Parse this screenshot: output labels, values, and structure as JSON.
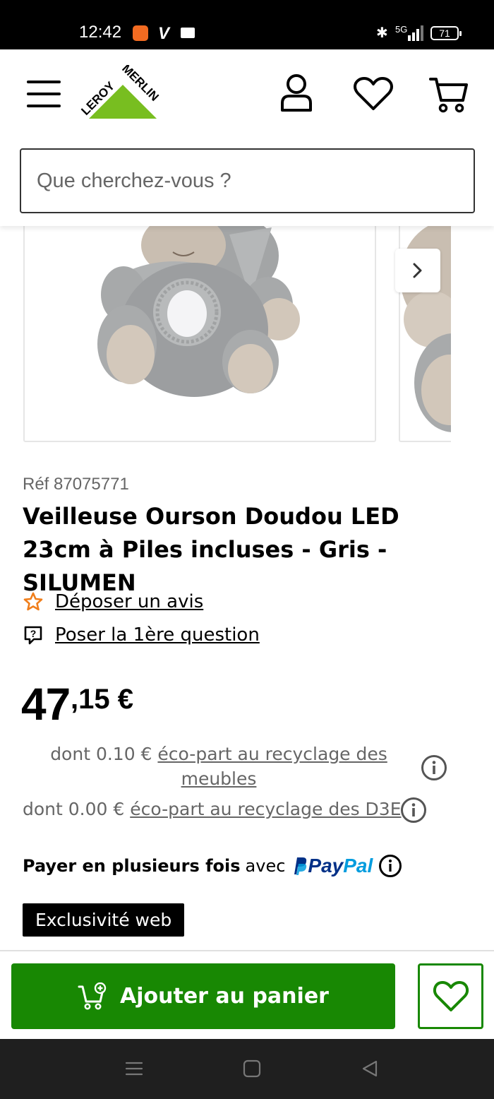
{
  "status_bar": {
    "time": "12:42",
    "network": "5G",
    "battery": "71"
  },
  "header": {
    "logo_text": "LEROY MERLIN",
    "search": {
      "placeholder": "Que cherchez-vous ?"
    }
  },
  "product": {
    "ref": "Réf 87075771",
    "title": "Veilleuse Ourson Doudou LED 23cm à Piles incluses - Gris - SILUMEN",
    "review_link": "Déposer un avis",
    "question_link": "Poser la 1ère question",
    "price": {
      "integer": "47",
      "decimal": ",15 €"
    },
    "eco_furniture": {
      "prefix": "dont 0.10 €",
      "link": "éco-part au recyclage des meubles"
    },
    "eco_d3e": {
      "prefix": "dont 0.00 €",
      "link": "éco-part au recyclage des D3E"
    },
    "payment": {
      "bold": "Payer en plusieurs fois",
      "normal": "avec",
      "provider_pay": "Pay",
      "provider_pal": "Pal"
    },
    "badge": "Exclusivité web"
  },
  "actions": {
    "add_to_cart": "Ajouter au panier"
  },
  "colors": {
    "brand_green": "#188803",
    "logo_green": "#78be20",
    "star_orange": "#f07e1b"
  }
}
